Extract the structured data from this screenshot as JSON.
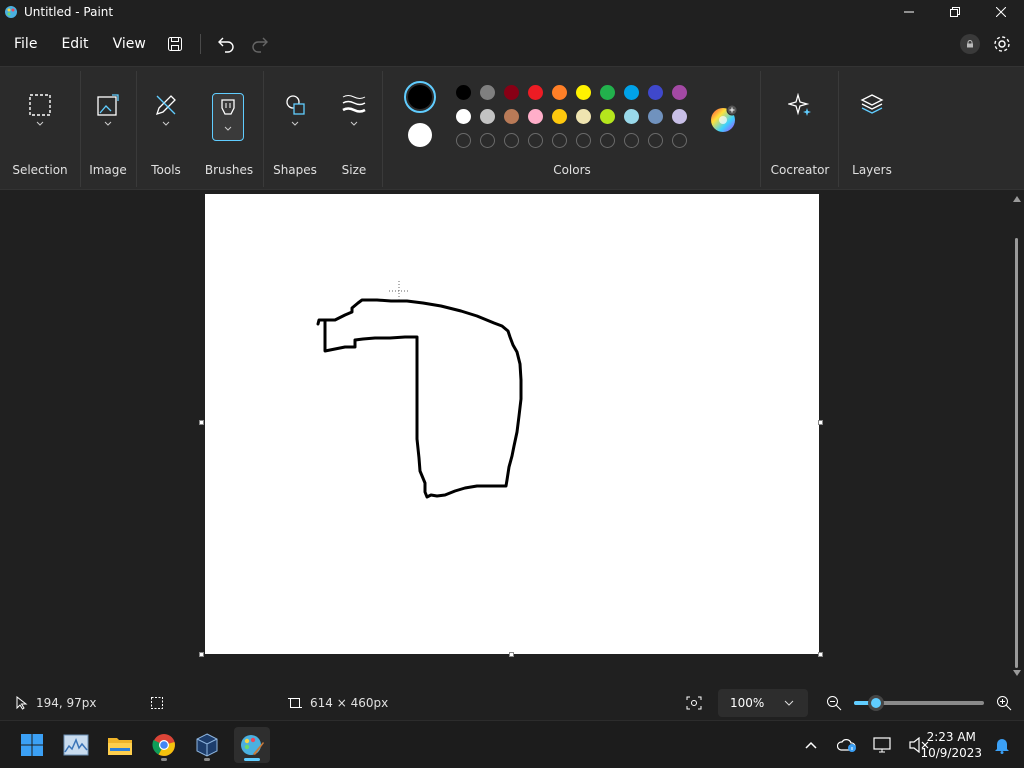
{
  "window": {
    "title": "Untitled - Paint"
  },
  "menu": {
    "file": "File",
    "edit": "Edit",
    "view": "View"
  },
  "ribbon": {
    "groups": {
      "selection": "Selection",
      "image": "Image",
      "tools": "Tools",
      "brushes": "Brushes",
      "shapes": "Shapes",
      "size": "Size",
      "colors": "Colors",
      "cocreator": "Cocreator",
      "layers": "Layers"
    },
    "primary_color": "#000000",
    "secondary_color": "#ffffff",
    "palette_row1": [
      "#000000",
      "#7f7f7f",
      "#880015",
      "#ed1c24",
      "#ff7f27",
      "#fff200",
      "#22b14c",
      "#00a2e8",
      "#3f48cc",
      "#a349a4"
    ],
    "palette_row2": [
      "#ffffff",
      "#c3c3c3",
      "#b97a57",
      "#ffaec9",
      "#ffc90e",
      "#efe4b0",
      "#b5e61d",
      "#99d9ea",
      "#7092be",
      "#c8bfe7"
    ]
  },
  "status": {
    "cursor_pos": "194, 97px",
    "canvas_size": "614 × 460px",
    "zoom": "100%",
    "zoom_slider_fraction": 0.17
  },
  "taskbar": {
    "time": "2:23 AM",
    "date": "10/9/2023"
  },
  "colors": {
    "accent": "#60cdff",
    "background": "#202020",
    "ribbon": "#2b2b2b"
  }
}
